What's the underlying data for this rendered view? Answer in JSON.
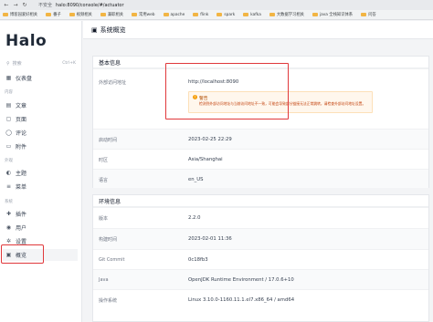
{
  "browser": {
    "insecure_label": "不安全",
    "url": "halo:8090/console/#/actuator",
    "bookmarks": [
      "博客园爱好相关",
      "番子",
      "视频相关",
      "兼职相关",
      "常用web",
      "apache",
      "flink",
      "spark",
      "kafka",
      "大数据学习相关",
      "java 全栈知识体系",
      "问答"
    ]
  },
  "sidebar": {
    "logo": "Halo",
    "search_placeholder": "搜索",
    "search_shortcut": "Ctrl+K",
    "dashboard": "仪表盘",
    "group_content": "内容",
    "content_items": [
      "文章",
      "页面",
      "评论",
      "附件"
    ],
    "group_appearance": "外观",
    "appearance_items": [
      "主题",
      "菜单"
    ],
    "group_system": "系统",
    "system_items": [
      "插件",
      "用户",
      "设置",
      "概览"
    ]
  },
  "header": {
    "title": "系统概览"
  },
  "basic": {
    "title": "基本信息",
    "external_url_label": "外部访问地址",
    "external_url_value": "http://localhost:8090",
    "warning_title": "警告",
    "warning_text": "检测到外部访问地址与当前访问地址不一致，可能会导致部分链接无法正常跳转，请检查外部访问地址设置。",
    "rows": [
      {
        "label": "启动时间",
        "value": "2023-02-25 22:29"
      },
      {
        "label": "时区",
        "value": "Asia/Shanghai"
      },
      {
        "label": "语言",
        "value": "en_US"
      }
    ]
  },
  "env": {
    "title": "环境信息",
    "rows": [
      {
        "label": "版本",
        "value": "2.2.0"
      },
      {
        "label": "构建时间",
        "value": "2023-02-01 11:36"
      },
      {
        "label": "Git Commit",
        "value": "0c18fb3"
      },
      {
        "label": "Java",
        "value": "OpenJDK Runtime Environment / 17.0.6+10"
      },
      {
        "label": "操作系统",
        "value": "Linux 3.10.0-1160.11.1.el7.x86_64 / amd64"
      }
    ]
  }
}
